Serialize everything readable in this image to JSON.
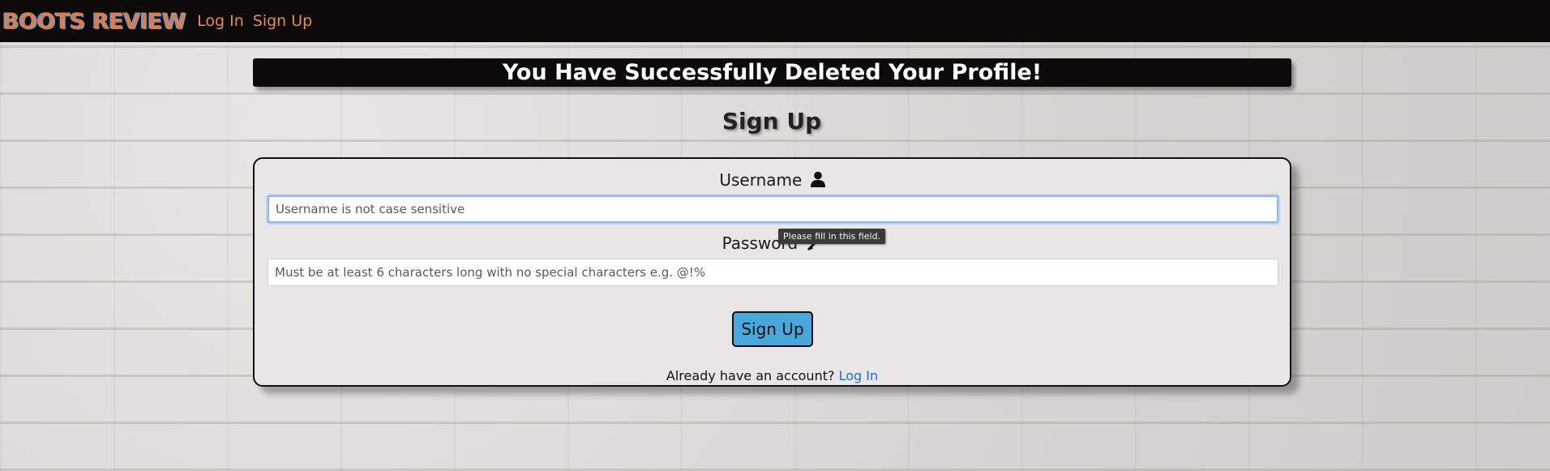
{
  "navbar": {
    "brand": "BOOTS REVIEW",
    "links": [
      {
        "label": "Log In"
      },
      {
        "label": "Sign Up"
      }
    ]
  },
  "banner": {
    "message": "You Have Successfully Deleted Your Profile!"
  },
  "page": {
    "title": "Sign Up"
  },
  "form": {
    "username": {
      "label": "Username",
      "icon": "user-icon",
      "placeholder": "Username is not case sensitive",
      "value": ""
    },
    "password": {
      "label": "Password",
      "icon": "key-icon",
      "placeholder": "Must be at least 6 characters long with no special characters e.g. @!%",
      "value": ""
    },
    "validation_tooltip": "Please fill in this field.",
    "submit_label": "Sign Up",
    "footer_text": "Already have an account?",
    "footer_link": "Log In"
  },
  "colors": {
    "navbar_bg": "#0d0b0a",
    "brand": "#e07b4a",
    "nav_link": "#e88a52",
    "button": "#4aa7dc",
    "link": "#1a6fd9"
  }
}
